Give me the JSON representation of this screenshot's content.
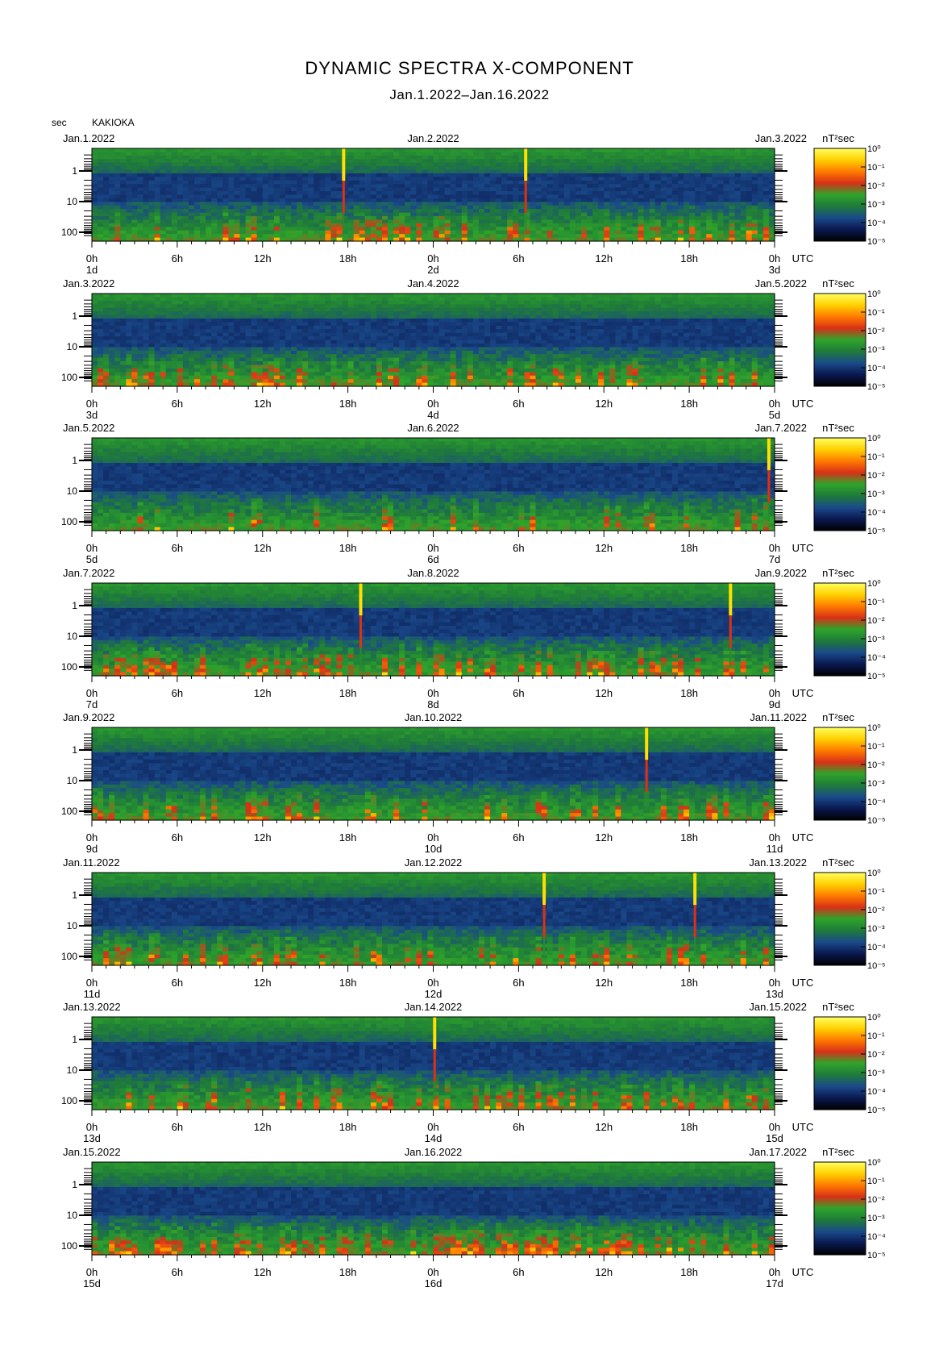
{
  "title": "DYNAMIC SPECTRA X-COMPONENT",
  "subtitle": "Jan.1.2022–Jan.16.2022",
  "y_unit_label": "sec",
  "station": "KAKIOKA",
  "colorbar_unit": "nT²sec",
  "colorbar_ticks": [
    "10⁰",
    "10⁻¹",
    "10⁻²",
    "10⁻³",
    "10⁻⁴",
    "10⁻⁵"
  ],
  "x_ticks": [
    "0h",
    "6h",
    "12h",
    "18h",
    "0h",
    "6h",
    "12h",
    "18h",
    "0h"
  ],
  "utc_label": "UTC",
  "colors": {
    "colormap": [
      "#000000",
      "#0a1850",
      "#1a4a8a",
      "#1f7a3a",
      "#2ea42a",
      "#d83018",
      "#ff7a00",
      "#ffd000",
      "#ffff60"
    ]
  },
  "chart_data": [
    {
      "type": "heatmap",
      "date_left": "Jan.1.2022",
      "date_mid": "Jan.2.2022",
      "date_right": "Jan.3.2022",
      "day_left": "1d",
      "day_mid": "2d",
      "day_right": "3d",
      "y_ticks": [
        "1",
        "10",
        "100"
      ],
      "x_ticks": [
        "0h",
        "6h",
        "12h",
        "18h",
        "0h",
        "6h",
        "12h",
        "18h",
        "0h"
      ],
      "pulses_hours": [
        17.7,
        30.5
      ],
      "red_activity": 0.35
    },
    {
      "type": "heatmap",
      "date_left": "Jan.3.2022",
      "date_mid": "Jan.4.2022",
      "date_right": "Jan.5.2022",
      "day_left": "3d",
      "day_mid": "4d",
      "day_right": "5d",
      "y_ticks": [
        "1",
        "10",
        "100"
      ],
      "x_ticks": [
        "0h",
        "6h",
        "12h",
        "18h",
        "0h",
        "6h",
        "12h",
        "18h",
        "0h"
      ],
      "pulses_hours": [],
      "red_activity": 0.3
    },
    {
      "type": "heatmap",
      "date_left": "Jan.5.2022",
      "date_mid": "Jan.6.2022",
      "date_right": "Jan.7.2022",
      "day_left": "5d",
      "day_mid": "6d",
      "day_right": "7d",
      "y_ticks": [
        "1",
        "10",
        "100"
      ],
      "x_ticks": [
        "0h",
        "6h",
        "12h",
        "18h",
        "0h",
        "6h",
        "12h",
        "18h",
        "0h"
      ],
      "pulses_hours": [
        47.6
      ],
      "red_activity": 0.15
    },
    {
      "type": "heatmap",
      "date_left": "Jan.7.2022",
      "date_mid": "Jan.8.2022",
      "date_right": "Jan.9.2022",
      "day_left": "7d",
      "day_mid": "8d",
      "day_right": "9d",
      "y_ticks": [
        "1",
        "10",
        "100"
      ],
      "x_ticks": [
        "0h",
        "6h",
        "12h",
        "18h",
        "0h",
        "6h",
        "12h",
        "18h",
        "0h"
      ],
      "pulses_hours": [
        18.9,
        44.9
      ],
      "red_activity": 0.45
    },
    {
      "type": "heatmap",
      "date_left": "Jan.9.2022",
      "date_mid": "Jan.10.2022",
      "date_right": "Jan.11.2022",
      "day_left": "9d",
      "day_mid": "10d",
      "day_right": "11d",
      "y_ticks": [
        "1",
        "10",
        "100"
      ],
      "x_ticks": [
        "0h",
        "6h",
        "12h",
        "18h",
        "0h",
        "6h",
        "12h",
        "18h",
        "0h"
      ],
      "pulses_hours": [
        39.0
      ],
      "red_activity": 0.35
    },
    {
      "type": "heatmap",
      "date_left": "Jan.11.2022",
      "date_mid": "Jan.12.2022",
      "date_right": "Jan.13.2022",
      "day_left": "11d",
      "day_mid": "12d",
      "day_right": "13d",
      "y_ticks": [
        "1",
        "10",
        "100"
      ],
      "x_ticks": [
        "0h",
        "6h",
        "12h",
        "18h",
        "0h",
        "6h",
        "12h",
        "18h",
        "0h"
      ],
      "pulses_hours": [
        31.8,
        42.4
      ],
      "red_activity": 0.25
    },
    {
      "type": "heatmap",
      "date_left": "Jan.13.2022",
      "date_mid": "Jan.14.2022",
      "date_right": "Jan.15.2022",
      "day_left": "13d",
      "day_mid": "14d",
      "day_right": "15d",
      "y_ticks": [
        "1",
        "10",
        "100"
      ],
      "x_ticks": [
        "0h",
        "6h",
        "12h",
        "18h",
        "0h",
        "6h",
        "12h",
        "18h",
        "0h"
      ],
      "pulses_hours": [
        24.1
      ],
      "red_activity": 0.4
    },
    {
      "type": "heatmap",
      "date_left": "Jan.15.2022",
      "date_mid": "Jan.16.2022",
      "date_right": "Jan.17.2022",
      "day_left": "15d",
      "day_mid": "16d",
      "day_right": "17d",
      "y_ticks": [
        "1",
        "10",
        "100"
      ],
      "x_ticks": [
        "0h",
        "6h",
        "12h",
        "18h",
        "0h",
        "6h",
        "12h",
        "18h",
        "0h"
      ],
      "pulses_hours": [],
      "red_activity": 0.6
    }
  ]
}
